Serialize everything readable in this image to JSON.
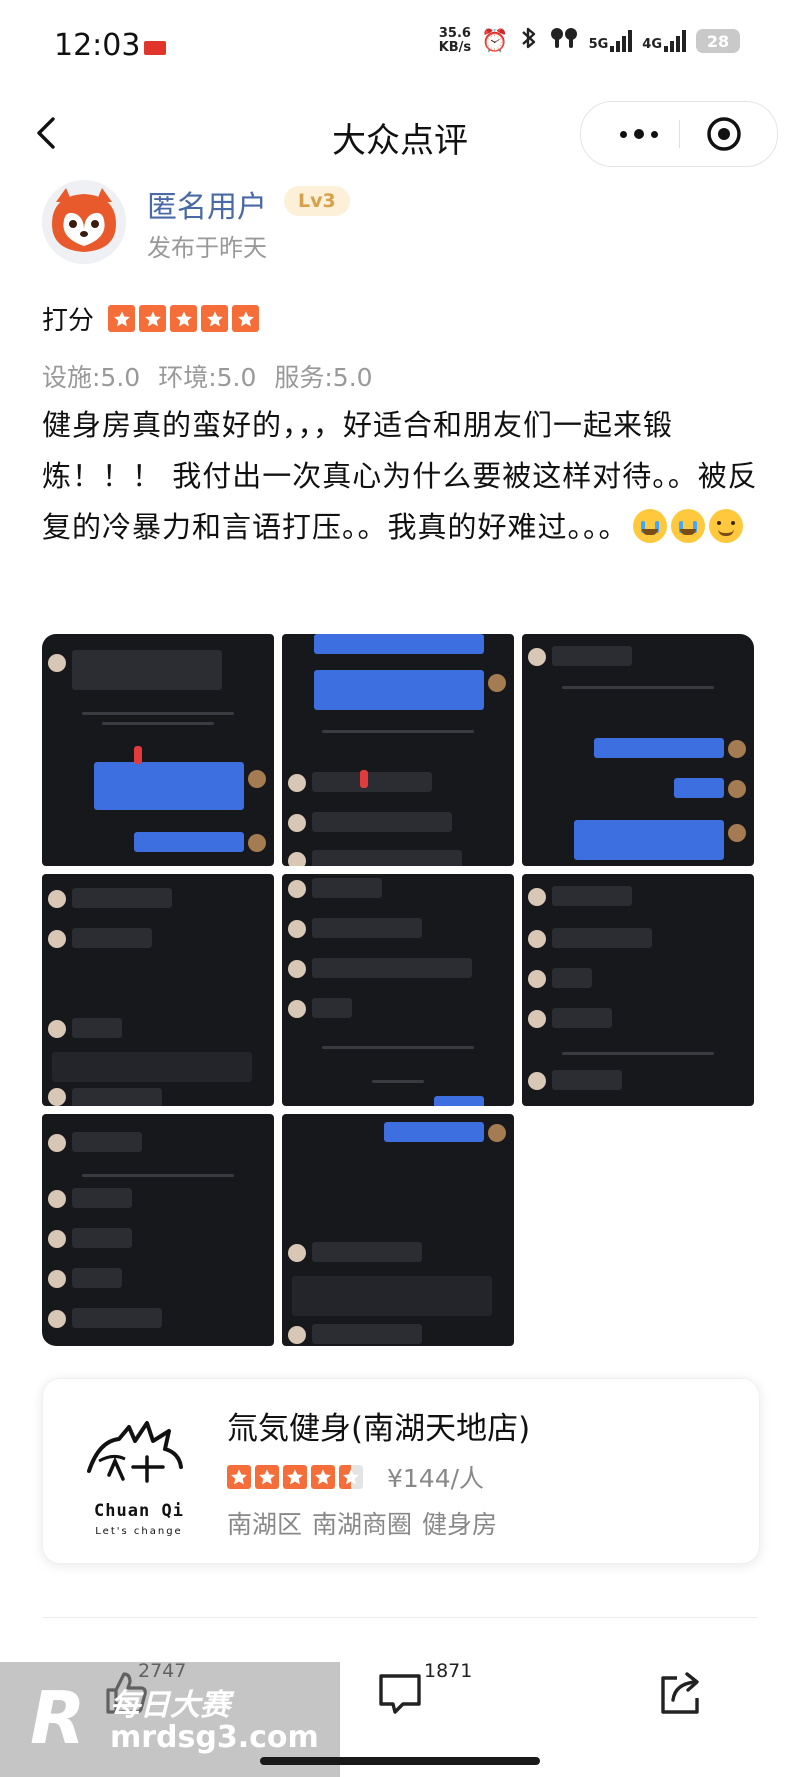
{
  "status_bar": {
    "time": "12:03",
    "net_speed_value": "35.6",
    "net_speed_unit": "KB/s",
    "signal_1": "5G",
    "signal_2": "4G",
    "battery": "28",
    "icons": [
      "alarm-icon",
      "bluetooth-icon",
      "earbuds-icon",
      "signal-5g-icon",
      "signal-4g-icon",
      "battery-icon"
    ]
  },
  "nav": {
    "title": "大众点评",
    "back_icon": "chevron-left-icon",
    "more_icon": "more-dots-icon",
    "close_icon": "target-close-icon"
  },
  "author": {
    "name": "匿名用户",
    "level": "Lv3",
    "posted": "发布于昨天",
    "avatar_icon": "red-panda-avatar"
  },
  "rating": {
    "label": "打分",
    "stars": 5,
    "scores": [
      "设施:5.0",
      "环境:5.0",
      "服务:5.0"
    ],
    "accent_color": "#f56e3a"
  },
  "review": {
    "text": "健身房真的蛮好的，，，好适合和朋友们一起来锻炼！！！ 我付出一次真心为什么要被这样对待。。被反复的冷暴力和言语打压。。我真的好难过。。。",
    "emojis": [
      "loudly-crying-face",
      "loudly-crying-face",
      "smiling-face-with-tear"
    ]
  },
  "photos": {
    "count": 8,
    "kind": "chat screenshots"
  },
  "shop": {
    "name": "氚気健身(南湖天地店)",
    "stars": 4.5,
    "price": "¥144/人",
    "district": "南湖区",
    "area": "南湖商圈",
    "category": "健身房",
    "logo_text": "Chuan Qi",
    "logo_tagline": "Let's change"
  },
  "actions": {
    "likes": "2747",
    "comments": "1871",
    "like_icon": "thumbs-up-icon",
    "comment_icon": "comment-icon",
    "share_icon": "share-icon"
  },
  "watermark": {
    "brand": "每日大赛",
    "url": "mrdsg3.com"
  }
}
